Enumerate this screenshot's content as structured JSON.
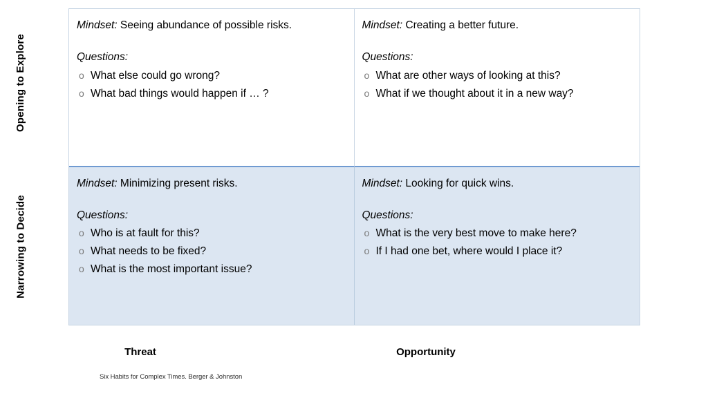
{
  "axes": {
    "vertical": {
      "top_label": "Opening to Explore",
      "bottom_label": "Narrowing to Decide"
    },
    "horizontal": {
      "left_label": "Threat",
      "right_label": "Opportunity"
    }
  },
  "labels": {
    "mindset_prefix": "Mindset:",
    "questions_heading": "Questions:",
    "bullet_glyph": "o"
  },
  "quadrants": {
    "top_left": {
      "mindset": "Seeing abundance of possible risks.",
      "questions": [
        "What else could go wrong?",
        "What bad things would happen if … ?"
      ]
    },
    "top_right": {
      "mindset": "Creating a better future.",
      "questions": [
        "What are other ways of looking at this?",
        "What if we thought about it in a new way?"
      ]
    },
    "bottom_left": {
      "mindset": "Minimizing present risks.",
      "questions": [
        "Who is at fault for this?",
        "What needs to be fixed?",
        "What is the most important issue?"
      ]
    },
    "bottom_right": {
      "mindset": "Looking for quick wins.",
      "questions": [
        "What is the very best move to make here?",
        "If I had one bet, where would I place it?"
      ]
    }
  },
  "citation": "Six Habits for Complex Times. Berger & Johnston",
  "colors": {
    "quadrant_fill_bottom": "#dce6f2",
    "quadrant_fill_top": "#ffffff",
    "grid_border": "#c6d4e3",
    "row_divider": "#6f9ad1",
    "bullet": "#7a7a7a"
  }
}
